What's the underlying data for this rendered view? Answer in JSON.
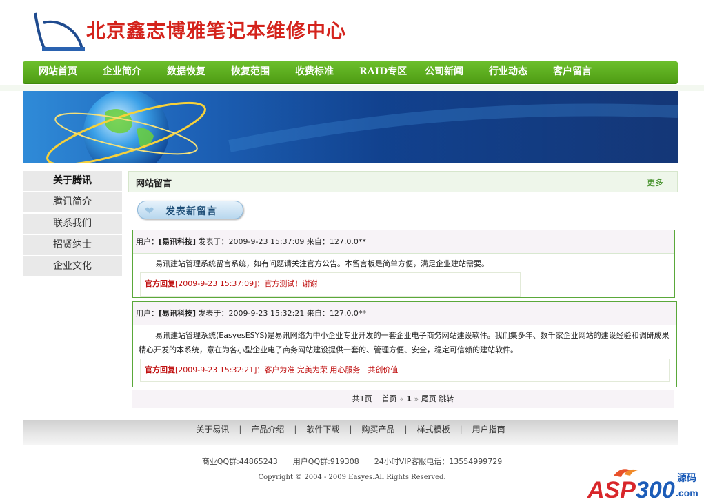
{
  "header": {
    "site_name": "北京鑫志博雅笔记本维修中心"
  },
  "nav": [
    "网站首页",
    "企业简介",
    "数据恢复",
    "恢复范围",
    "收费标准",
    "RAID专区",
    "公司新闻",
    "行业动态",
    "客户留言"
  ],
  "sidebar": {
    "title": "关于腾讯",
    "items": [
      {
        "label": "腾讯简介"
      },
      {
        "label": "联系我们"
      },
      {
        "label": "招贤纳士"
      },
      {
        "label": "企业文化"
      }
    ]
  },
  "main": {
    "title": "网站留言",
    "more": "更多",
    "post_button": "发表新留言"
  },
  "messages": [
    {
      "prefix": "用户：",
      "user": "[易讯科技]",
      "meta": " 发表于：2009-9-23 15:37:09 来自：127.0.0**",
      "body": "易讯建站管理系统留言系统，如有问题请关注官方公告。本留言板是简单方便，满足企业建站需要。",
      "reply_label": "官方回复",
      "reply_text": "[2009-9-23 15:37:09]：官方测试！谢谢"
    },
    {
      "prefix": "用户：",
      "user": "[易讯科技]",
      "meta": " 发表于：2009-9-23 15:32:21 来自：127.0.0**",
      "body": "易讯建站管理系统(EasyesESYS)是易讯网络为中小企业专业开发的一套企业电子商务网站建设软件。我们集多年、数千家企业网站的建设经验和调研成果精心开发的本系统，意在为各小型企业电子商务网站建设提供一套的、管理方便、安全，稳定可信赖的建站软件。",
      "reply_label": "官方回复",
      "reply_text": "[2009-9-23 15:32:21]：客户为准 完美为荣 用心服务　共创价值"
    }
  ],
  "pager": {
    "total": "共1页",
    "first": "首页",
    "prev": "«",
    "current": "1",
    "next": "»",
    "last": "尾页",
    "jump": "跳转"
  },
  "footer": {
    "links": [
      "关于易讯",
      "产品介绍",
      "软件下载",
      "购买产品",
      "样式模板",
      "用户指南"
    ],
    "sep": "|",
    "info": "商业QQ群:44865243　　用户QQ群:919308　　24小时VIP客服电话：13554999729",
    "copyright": "Copyright © 2004 - 2009 Easyes.All Rights Reserved."
  },
  "watermark": {
    "brand": "ASP300",
    "suffix_top": "源码",
    "suffix_bottom": ".com"
  },
  "colors": {
    "nav_green": "#5aad1f",
    "reply_red": "#c01010",
    "message_border": "#5aa83a",
    "title_red": "#d4231c"
  }
}
